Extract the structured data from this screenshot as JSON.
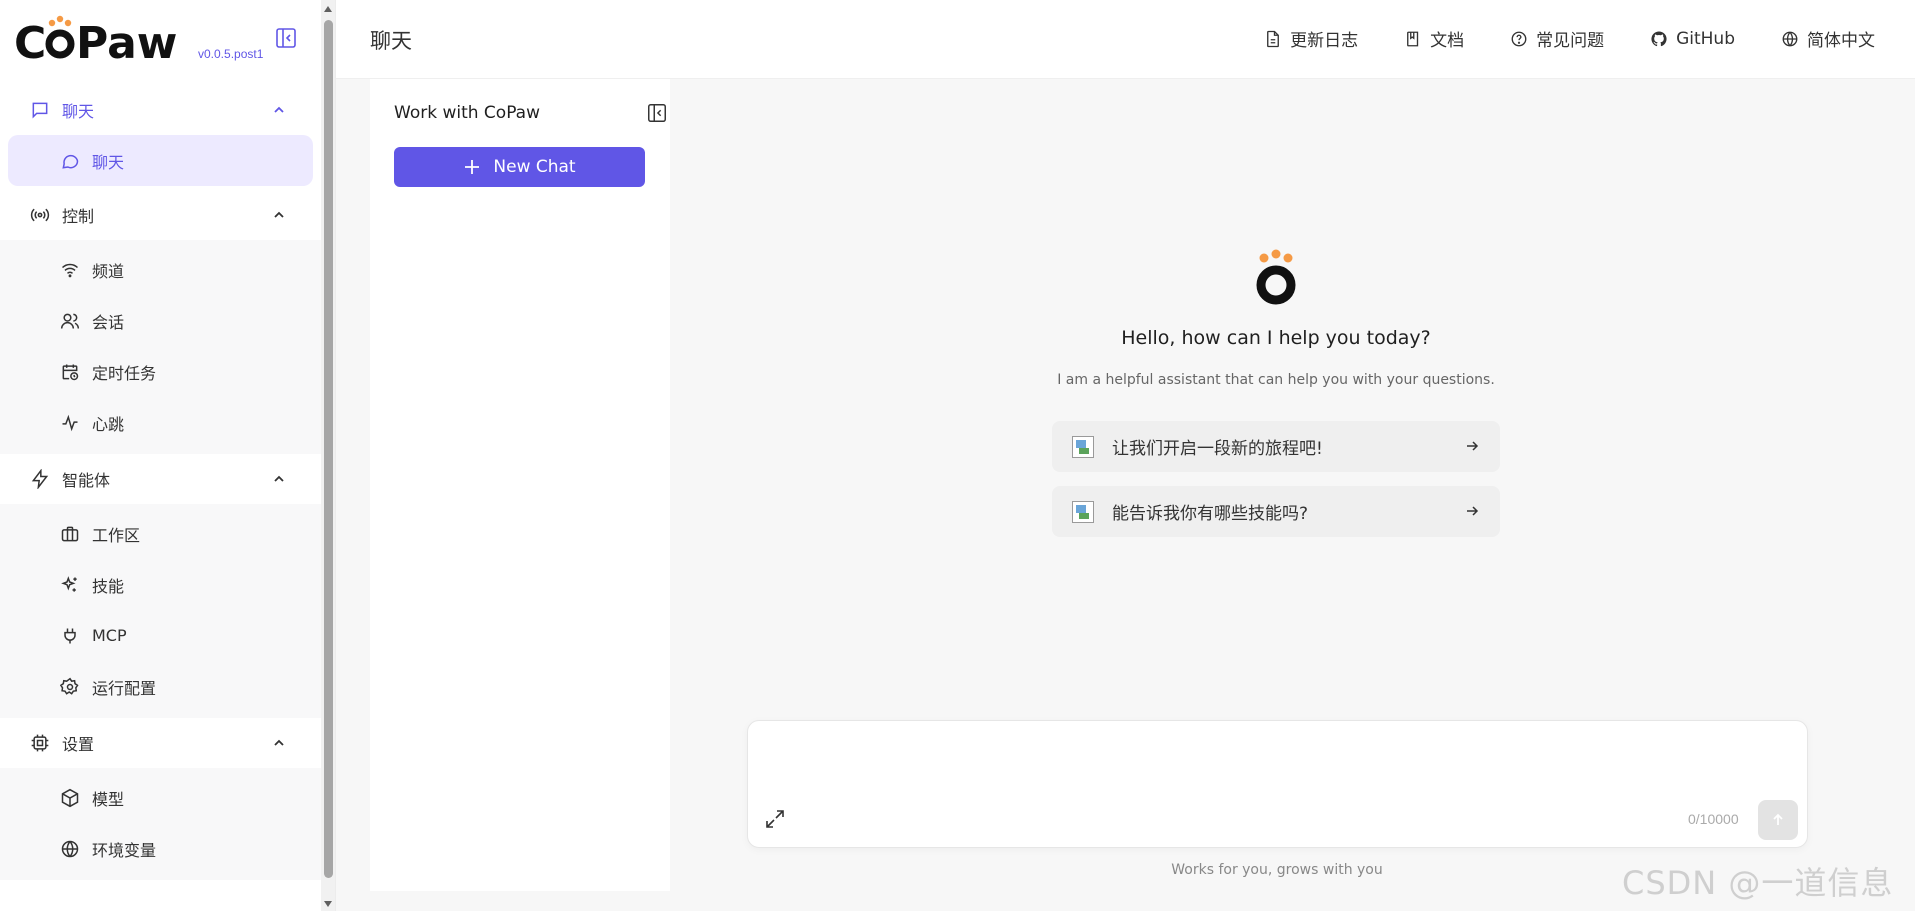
{
  "brand": {
    "name": "CoPaw",
    "version": "v0.0.5.post1",
    "accent": "#6056e6",
    "logo_dot_color": "#f59a45"
  },
  "sidebar": {
    "groups": [
      {
        "label": "聊天",
        "icon": "message-square-icon",
        "expanded": true,
        "active": true,
        "items": [
          {
            "label": "聊天",
            "icon": "message-circle-icon",
            "active": true
          }
        ]
      },
      {
        "label": "控制",
        "icon": "radio-broadcast-icon",
        "expanded": true,
        "items": [
          {
            "label": "频道",
            "icon": "wifi-icon"
          },
          {
            "label": "会话",
            "icon": "users-icon"
          },
          {
            "label": "定时任务",
            "icon": "calendar-clock-icon"
          },
          {
            "label": "心跳",
            "icon": "activity-icon"
          }
        ]
      },
      {
        "label": "智能体",
        "icon": "zap-icon",
        "expanded": true,
        "items": [
          {
            "label": "工作区",
            "icon": "briefcase-icon"
          },
          {
            "label": "技能",
            "icon": "sparkles-icon"
          },
          {
            "label": "MCP",
            "icon": "plug-icon"
          },
          {
            "label": "运行配置",
            "icon": "gear-icon"
          }
        ]
      },
      {
        "label": "设置",
        "icon": "cpu-icon",
        "expanded": true,
        "items": [
          {
            "label": "模型",
            "icon": "box-icon"
          },
          {
            "label": "环境变量",
            "icon": "globe-icon"
          }
        ]
      }
    ]
  },
  "header": {
    "title": "聊天",
    "links": [
      {
        "label": "更新日志",
        "icon": "file-text-icon"
      },
      {
        "label": "文档",
        "icon": "book-icon"
      },
      {
        "label": "常见问题",
        "icon": "help-circle-icon"
      },
      {
        "label": "GitHub",
        "icon": "github-icon"
      },
      {
        "label": "简体中文",
        "icon": "globe-icon"
      }
    ]
  },
  "sessions": {
    "title": "Work with CoPaw",
    "new_chat_label": "New Chat"
  },
  "welcome": {
    "title": "Hello, how can I help you today?",
    "subtitle": "I am a helpful assistant that can help you with your questions.",
    "prompts": [
      {
        "label": "让我们开启一段新的旅程吧!"
      },
      {
        "label": "能告诉我你有哪些技能吗?"
      }
    ]
  },
  "composer": {
    "value": "",
    "placeholder": "",
    "counter": "0/10000",
    "footer": "Works for you, grows with you"
  },
  "watermark": "CSDN @一道信息"
}
